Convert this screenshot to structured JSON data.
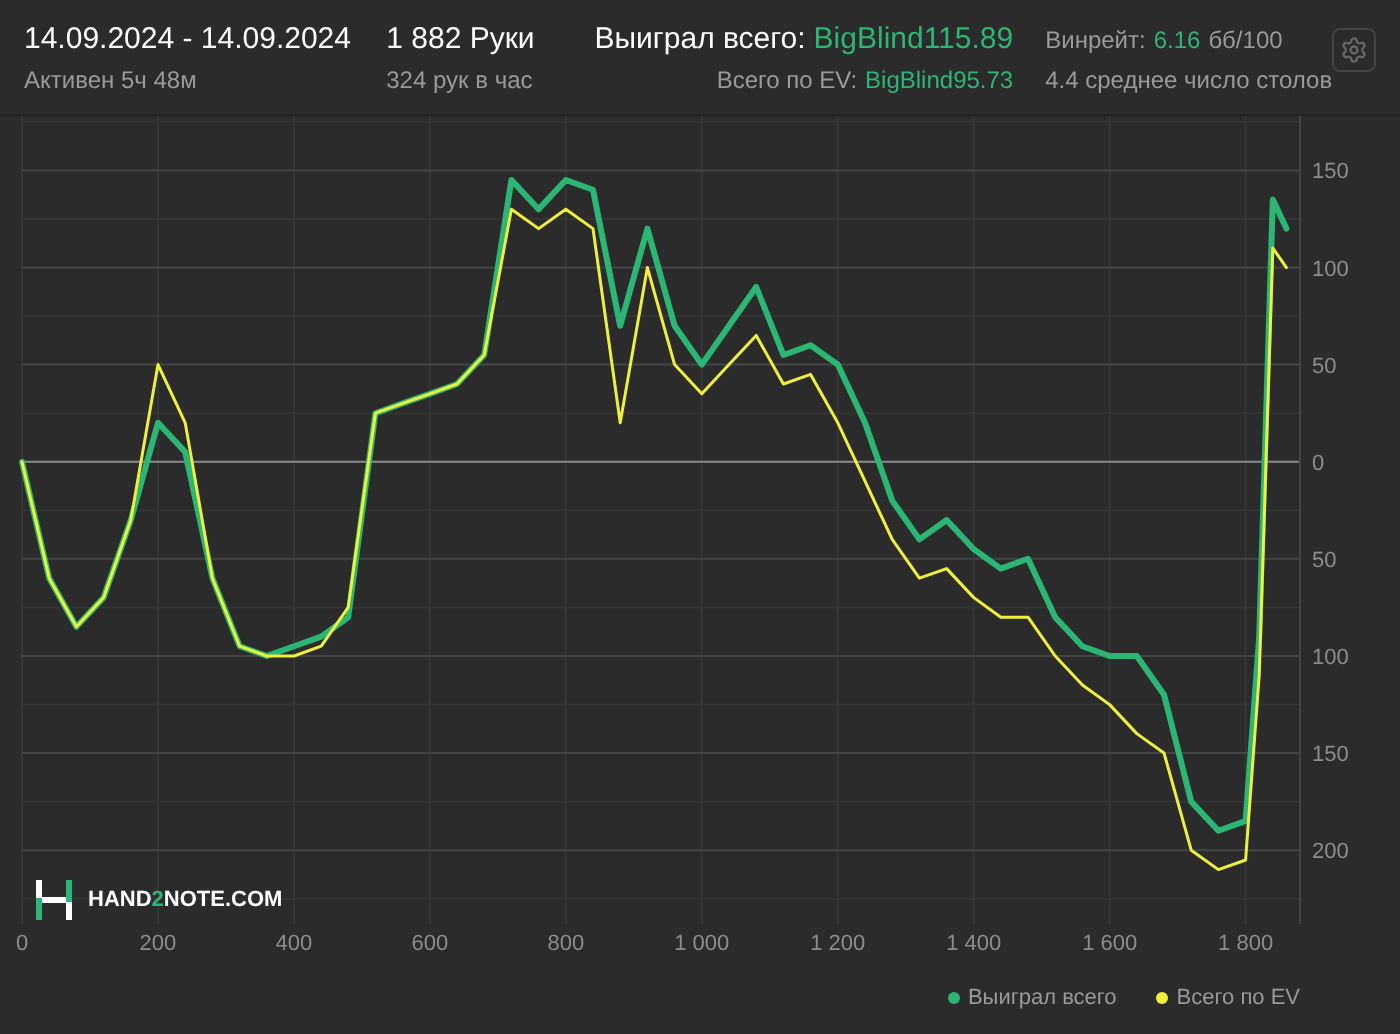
{
  "header": {
    "date_range": "14.09.2024 - 14.09.2024",
    "active": "Активен 5ч 48м",
    "hands": "1 882 Руки",
    "hands_per_hour": "324 рук в час",
    "won_label": "Выиграл всего:",
    "won_value": "BigBlind115.89",
    "ev_label": "Всего по EV:",
    "ev_value": "BigBlind95.73",
    "winrate_label": "Винрейт:",
    "winrate_value": "6.16",
    "winrate_unit": "бб/100",
    "tables": "4.4 среднее число столов"
  },
  "chart": {
    "logo": {
      "before": "HAND",
      "accent": "2",
      "after": "NOTE.COM"
    },
    "chart_data": {
      "type": "line",
      "grid": true,
      "xlim": [
        0,
        1880
      ],
      "ylim": [
        -238,
        178
      ],
      "xticks": [
        0,
        200,
        400,
        600,
        800,
        {
          "value": 1000,
          "label": "1 000"
        },
        {
          "value": 1200,
          "label": "1 200"
        },
        {
          "value": 1400,
          "label": "1 400"
        },
        {
          "value": 1600,
          "label": "1 600"
        },
        {
          "value": 1800,
          "label": "1 800"
        }
      ],
      "yticks": [
        150,
        100,
        50,
        0,
        {
          "value": -50,
          "label": "50"
        },
        {
          "value": -100,
          "label": "100"
        },
        {
          "value": -150,
          "label": "150"
        },
        {
          "value": -200,
          "label": "200"
        }
      ],
      "x": [
        0,
        40,
        80,
        120,
        160,
        200,
        240,
        280,
        320,
        360,
        400,
        440,
        480,
        520,
        560,
        600,
        640,
        680,
        720,
        760,
        800,
        840,
        880,
        920,
        960,
        1000,
        1040,
        1080,
        1120,
        1160,
        1200,
        1240,
        1280,
        1320,
        1360,
        1400,
        1440,
        1480,
        1520,
        1560,
        1600,
        1640,
        1680,
        1720,
        1760,
        1800,
        1820,
        1840,
        1860
      ],
      "series": [
        {
          "name": "Выиграл всего",
          "color": "#2bb673",
          "values": [
            0,
            -60,
            -85,
            -70,
            -30,
            20,
            5,
            -60,
            -95,
            -100,
            -95,
            -90,
            -80,
            25,
            30,
            35,
            40,
            55,
            145,
            130,
            145,
            140,
            70,
            120,
            70,
            50,
            70,
            90,
            55,
            60,
            50,
            20,
            -20,
            -40,
            -30,
            -45,
            -55,
            -50,
            -80,
            -95,
            -100,
            -100,
            -120,
            -175,
            -190,
            -185,
            -90,
            135,
            120
          ]
        },
        {
          "name": "Всего по EV",
          "color": "#f0ef3c",
          "values": [
            0,
            -60,
            -85,
            -70,
            -30,
            50,
            20,
            -60,
            -95,
            -100,
            -100,
            -95,
            -75,
            25,
            30,
            35,
            40,
            55,
            130,
            120,
            130,
            120,
            20,
            100,
            50,
            35,
            50,
            65,
            40,
            45,
            20,
            -10,
            -40,
            -60,
            -55,
            -70,
            -80,
            -80,
            -100,
            -115,
            -125,
            -140,
            -150,
            -200,
            -210,
            -205,
            -110,
            110,
            100
          ]
        }
      ]
    }
  }
}
